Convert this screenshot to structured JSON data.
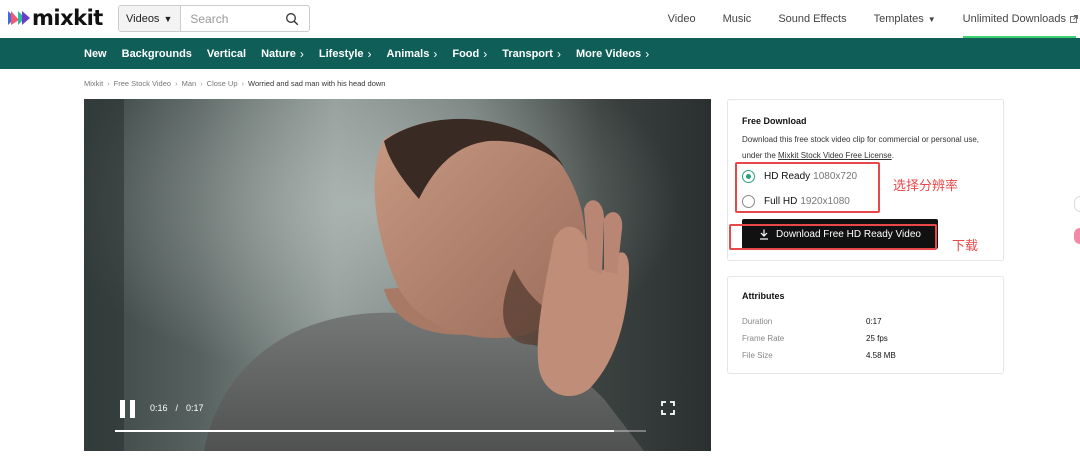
{
  "header": {
    "logo_text": "mixkit",
    "search": {
      "category": "Videos",
      "placeholder": "Search"
    },
    "nav": [
      {
        "label": "Video"
      },
      {
        "label": "Music"
      },
      {
        "label": "Sound Effects"
      },
      {
        "label": "Templates",
        "has_dropdown": true
      },
      {
        "label": "Unlimited Downloads",
        "external": true
      }
    ]
  },
  "categories": [
    {
      "label": "New",
      "has_chevron": false
    },
    {
      "label": "Backgrounds",
      "has_chevron": false
    },
    {
      "label": "Vertical",
      "has_chevron": false
    },
    {
      "label": "Nature",
      "has_chevron": true
    },
    {
      "label": "Lifestyle",
      "has_chevron": true
    },
    {
      "label": "Animals",
      "has_chevron": true
    },
    {
      "label": "Food",
      "has_chevron": true
    },
    {
      "label": "Transport",
      "has_chevron": true
    },
    {
      "label": "More Videos",
      "has_chevron": true
    }
  ],
  "breadcrumb": [
    "Mixkit",
    "Free Stock Video",
    "Man",
    "Close Up",
    "Worried and sad man with his head down"
  ],
  "player": {
    "current_time": "0:16",
    "duration": "0:17",
    "progress_fraction": 0.94
  },
  "download": {
    "title": "Free Download",
    "description": "Download this free stock video clip for commercial or personal use, under the",
    "license_link": "Mixkit Stock Video Free License",
    "description_end": ".",
    "options": [
      {
        "name": "HD Ready",
        "resolution": "1080x720",
        "selected": true
      },
      {
        "name": "Full HD",
        "resolution": "1920x1080",
        "selected": false
      }
    ],
    "button_label": "Download Free HD Ready Video"
  },
  "annotations": {
    "resolution_note": "选择分辨率",
    "download_note": "下载",
    "color": "#e8484a"
  },
  "attributes": {
    "title": "Attributes",
    "rows": [
      {
        "key": "Duration",
        "value": "0:17"
      },
      {
        "key": "Frame Rate",
        "value": "25 fps"
      },
      {
        "key": "File Size",
        "value": "4.58 MB"
      }
    ]
  },
  "colors": {
    "category_bar": "#0f5f58",
    "accent_green": "#3bd16f",
    "radio_selected": "#2ba07a",
    "button_bg": "#111111"
  }
}
